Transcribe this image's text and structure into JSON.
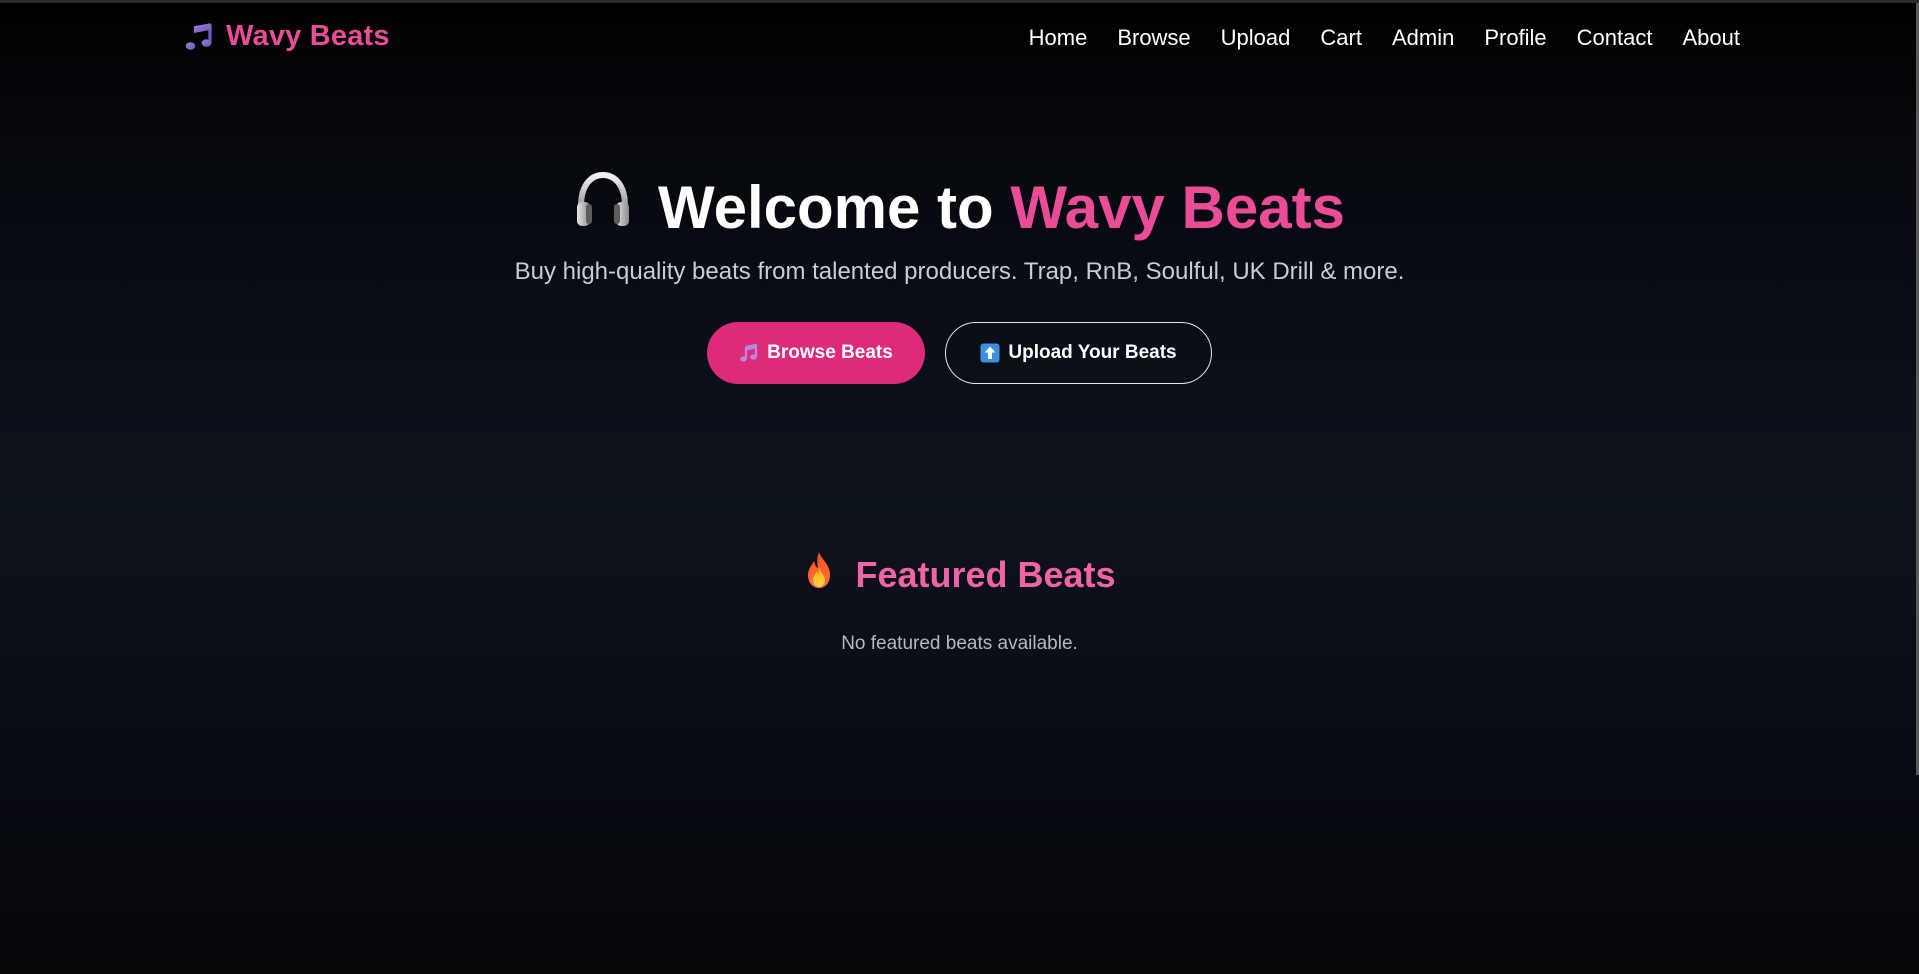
{
  "brand": {
    "name": "Wavy Beats",
    "icon": "music-note-icon",
    "color": "#ea4c98"
  },
  "nav": {
    "items": [
      "Home",
      "Browse",
      "Upload",
      "Cart",
      "Admin",
      "Profile",
      "Contact",
      "About"
    ]
  },
  "hero": {
    "icon": "headphones-icon",
    "title_prefix": "Welcome to",
    "title_accent": "Wavy Beats",
    "subtitle": "Buy high-quality beats from talented producers. Trap, RnB, Soulful, UK Drill & more.",
    "primary_button": {
      "icon": "music-note-icon",
      "label": "Browse Beats"
    },
    "secondary_button": {
      "icon": "up-arrow-icon",
      "label": "Upload Your Beats"
    }
  },
  "featured": {
    "icon": "fire-icon",
    "title": "Featured Beats",
    "empty_message": "No featured beats available."
  },
  "colors": {
    "accent": "#ea4c98",
    "primary_button": "#de2a7a",
    "background": "#0b1019"
  }
}
